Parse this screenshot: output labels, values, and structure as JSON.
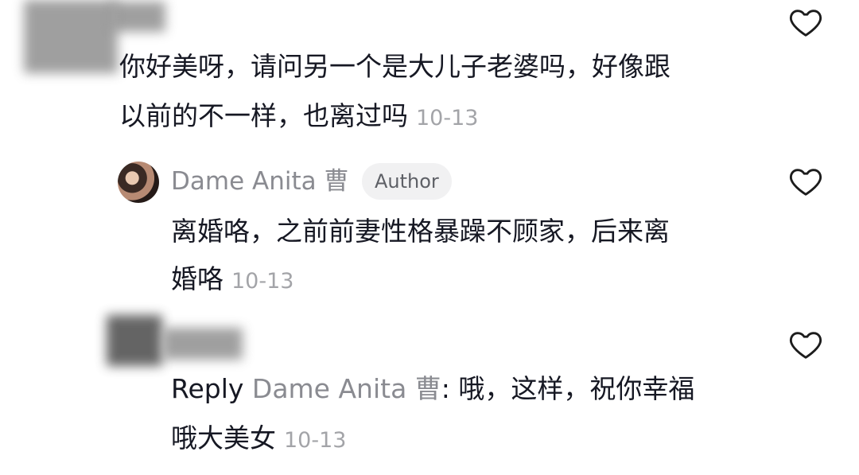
{
  "comment1": {
    "line1": "你好美呀，请问另一个是大儿子老婆吗，好像跟",
    "line2": "以前的不一样，也离过吗",
    "date": "10-13"
  },
  "reply1": {
    "username": "Dame Anita 曹",
    "badge": "Author",
    "line1": "离婚咯，之前前妻性格暴躁不顾家，后来离",
    "line2": "婚咯",
    "date": "10-13"
  },
  "reply2": {
    "reply_word": "Reply",
    "reply_to": "Dame Anita 曹",
    "line1_rest": ": 哦，这样，祝你幸福",
    "line2": "哦大美女",
    "date": "10-13"
  },
  "icons": {
    "like": "heart-outline-icon"
  }
}
